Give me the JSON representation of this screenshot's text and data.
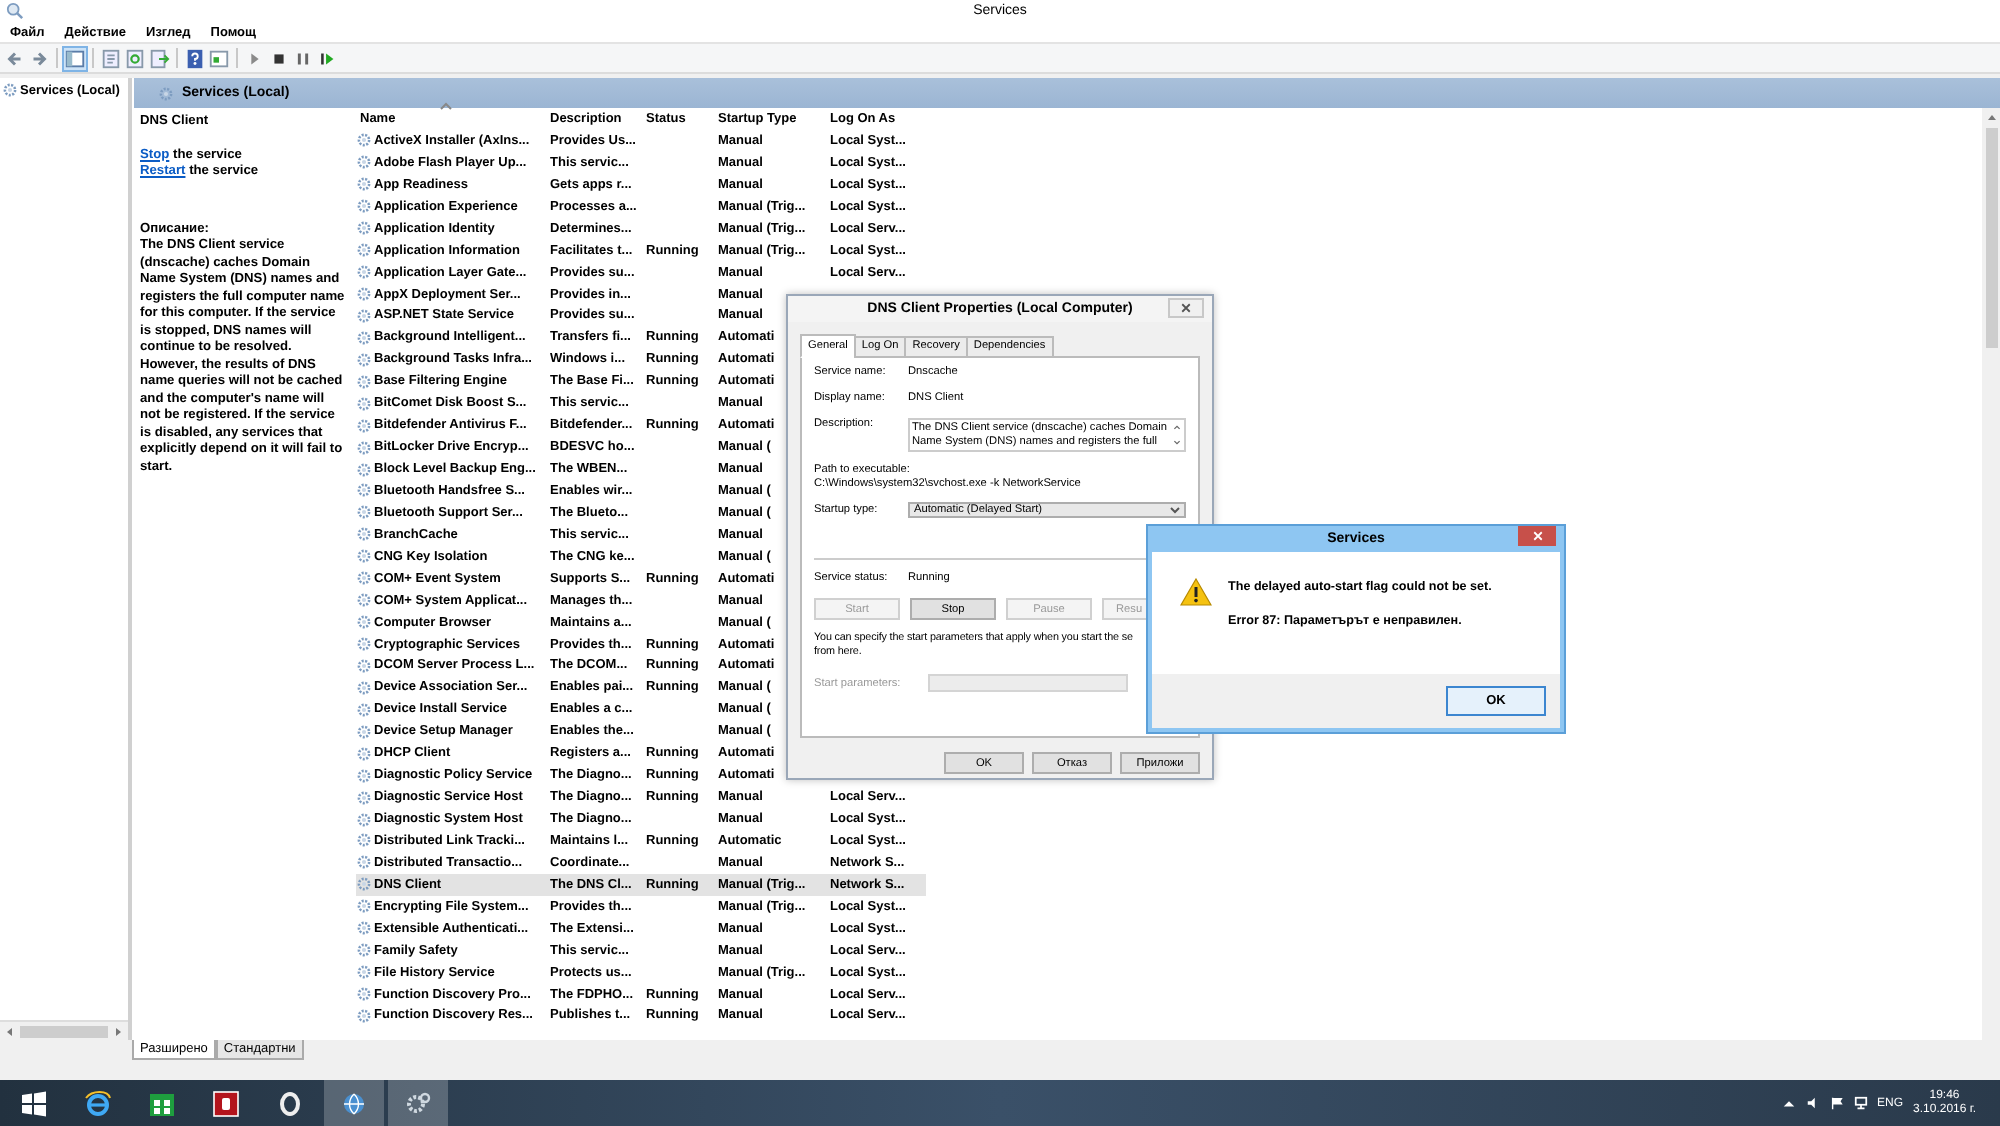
{
  "window": {
    "title": "Services"
  },
  "menu": [
    "Файл",
    "Действие",
    "Изглед",
    "Помощ"
  ],
  "tree": {
    "items": [
      {
        "label": "Services (Local)"
      }
    ]
  },
  "pane_title": "Services (Local)",
  "details": {
    "title": "DNS Client",
    "actions": [
      {
        "link": "Stop",
        "text": "the service"
      },
      {
        "link": "Restart",
        "text": "the service"
      }
    ],
    "description_label": "Описание:",
    "description": "The DNS Client service (dnscache) caches Domain Name System (DNS) names and registers the full computer name for this computer. If the service is stopped, DNS names will continue to be resolved. However, the results of DNS name queries will not be cached and the computer's name will not be registered. If the service is disabled, any services that explicitly depend on it will fail to start."
  },
  "table": {
    "columns": [
      "Name",
      "Description",
      "Status",
      "Startup Type",
      "Log On As"
    ],
    "rows": [
      {
        "name": "ActiveX Installer (AxIns...",
        "description": "Provides Us...",
        "status": "",
        "startup_type": "Manual",
        "log_on_as": "Local Syst...",
        "selected": false
      },
      {
        "name": "Adobe Flash Player Up...",
        "description": "This servic...",
        "status": "",
        "startup_type": "Manual",
        "log_on_as": "Local Syst...",
        "selected": false
      },
      {
        "name": "App Readiness",
        "description": "Gets apps r...",
        "status": "",
        "startup_type": "Manual",
        "log_on_as": "Local Syst...",
        "selected": false
      },
      {
        "name": "Application Experience",
        "description": "Processes a...",
        "status": "",
        "startup_type": "Manual (Trig...",
        "log_on_as": "Local Syst...",
        "selected": false
      },
      {
        "name": "Application Identity",
        "description": "Determines...",
        "status": "",
        "startup_type": "Manual (Trig...",
        "log_on_as": "Local Serv...",
        "selected": false
      },
      {
        "name": "Application Information",
        "description": "Facilitates t...",
        "status": "Running",
        "startup_type": "Manual (Trig...",
        "log_on_as": "Local Syst...",
        "selected": false
      },
      {
        "name": "Application Layer Gate...",
        "description": "Provides su...",
        "status": "",
        "startup_type": "Manual",
        "log_on_as": "Local Serv...",
        "selected": false
      },
      {
        "name": "AppX Deployment Ser...",
        "description": "Provides in...",
        "status": "",
        "startup_type": "Manual",
        "log_on_as": "",
        "selected": false
      },
      {
        "name": "ASP.NET State Service",
        "description": "Provides su...",
        "status": "",
        "startup_type": "Manual",
        "log_on_as": "",
        "selected": false
      },
      {
        "name": "Background Intelligent...",
        "description": "Transfers fi...",
        "status": "Running",
        "startup_type": "Automati",
        "log_on_as": "",
        "selected": false
      },
      {
        "name": "Background Tasks Infra...",
        "description": "Windows i...",
        "status": "Running",
        "startup_type": "Automati",
        "log_on_as": "",
        "selected": false
      },
      {
        "name": "Base Filtering Engine",
        "description": "The Base Fi...",
        "status": "Running",
        "startup_type": "Automati",
        "log_on_as": "",
        "selected": false
      },
      {
        "name": "BitComet Disk Boost S...",
        "description": "This servic...",
        "status": "",
        "startup_type": "Manual",
        "log_on_as": "",
        "selected": false
      },
      {
        "name": "Bitdefender Antivirus F...",
        "description": "Bitdefender...",
        "status": "Running",
        "startup_type": "Automati",
        "log_on_as": "",
        "selected": false
      },
      {
        "name": "BitLocker Drive Encryp...",
        "description": "BDESVC ho...",
        "status": "",
        "startup_type": "Manual (",
        "log_on_as": "",
        "selected": false
      },
      {
        "name": "Block Level Backup Eng...",
        "description": "The WBEN...",
        "status": "",
        "startup_type": "Manual",
        "log_on_as": "",
        "selected": false
      },
      {
        "name": "Bluetooth Handsfree S...",
        "description": "Enables wir...",
        "status": "",
        "startup_type": "Manual (",
        "log_on_as": "",
        "selected": false
      },
      {
        "name": "Bluetooth Support Ser...",
        "description": "The Blueto...",
        "status": "",
        "startup_type": "Manual (",
        "log_on_as": "",
        "selected": false
      },
      {
        "name": "BranchCache",
        "description": "This servic...",
        "status": "",
        "startup_type": "Manual",
        "log_on_as": "",
        "selected": false
      },
      {
        "name": "CNG Key Isolation",
        "description": "The CNG ke...",
        "status": "",
        "startup_type": "Manual (",
        "log_on_as": "",
        "selected": false
      },
      {
        "name": "COM+ Event System",
        "description": "Supports S...",
        "status": "Running",
        "startup_type": "Automati",
        "log_on_as": "",
        "selected": false
      },
      {
        "name": "COM+ System Applicat...",
        "description": "Manages th...",
        "status": "",
        "startup_type": "Manual",
        "log_on_as": "",
        "selected": false
      },
      {
        "name": "Computer Browser",
        "description": "Maintains a...",
        "status": "",
        "startup_type": "Manual (",
        "log_on_as": "",
        "selected": false
      },
      {
        "name": "Cryptographic Services",
        "description": "Provides th...",
        "status": "Running",
        "startup_type": "Automati",
        "log_on_as": "",
        "selected": false
      },
      {
        "name": "DCOM Server Process L...",
        "description": "The DCOM...",
        "status": "Running",
        "startup_type": "Automati",
        "log_on_as": "",
        "selected": false
      },
      {
        "name": "Device Association Ser...",
        "description": "Enables pai...",
        "status": "Running",
        "startup_type": "Manual (",
        "log_on_as": "",
        "selected": false
      },
      {
        "name": "Device Install Service",
        "description": "Enables a c...",
        "status": "",
        "startup_type": "Manual (",
        "log_on_as": "",
        "selected": false
      },
      {
        "name": "Device Setup Manager",
        "description": "Enables the...",
        "status": "",
        "startup_type": "Manual (",
        "log_on_as": "",
        "selected": false
      },
      {
        "name": "DHCP Client",
        "description": "Registers a...",
        "status": "Running",
        "startup_type": "Automati",
        "log_on_as": "",
        "selected": false
      },
      {
        "name": "Diagnostic Policy Service",
        "description": "The Diagno...",
        "status": "Running",
        "startup_type": "Automati",
        "log_on_as": "",
        "selected": false
      },
      {
        "name": "Diagnostic Service Host",
        "description": "The Diagno...",
        "status": "Running",
        "startup_type": "Manual",
        "log_on_as": "Local Serv...",
        "selected": false
      },
      {
        "name": "Diagnostic System Host",
        "description": "The Diagno...",
        "status": "",
        "startup_type": "Manual",
        "log_on_as": "Local Syst...",
        "selected": false
      },
      {
        "name": "Distributed Link Tracki...",
        "description": "Maintains l...",
        "status": "Running",
        "startup_type": "Automatic",
        "log_on_as": "Local Syst...",
        "selected": false
      },
      {
        "name": "Distributed Transactio...",
        "description": "Coordinate...",
        "status": "",
        "startup_type": "Manual",
        "log_on_as": "Network S...",
        "selected": false
      },
      {
        "name": "DNS Client",
        "description": "The DNS Cl...",
        "status": "Running",
        "startup_type": "Manual (Trig...",
        "log_on_as": "Network S...",
        "selected": true
      },
      {
        "name": "Encrypting File System...",
        "description": "Provides th...",
        "status": "",
        "startup_type": "Manual (Trig...",
        "log_on_as": "Local Syst...",
        "selected": false
      },
      {
        "name": "Extensible Authenticati...",
        "description": "The Extensi...",
        "status": "",
        "startup_type": "Manual",
        "log_on_as": "Local Syst...",
        "selected": false
      },
      {
        "name": "Family Safety",
        "description": "This servic...",
        "status": "",
        "startup_type": "Manual",
        "log_on_as": "Local Serv...",
        "selected": false
      },
      {
        "name": "File History Service",
        "description": "Protects us...",
        "status": "",
        "startup_type": "Manual (Trig...",
        "log_on_as": "Local Syst...",
        "selected": false
      },
      {
        "name": "Function Discovery Pro...",
        "description": "The FDPHO...",
        "status": "Running",
        "startup_type": "Manual",
        "log_on_as": "Local Serv...",
        "selected": false
      },
      {
        "name": "Function Discovery Res...",
        "description": "Publishes t...",
        "status": "Running",
        "startup_type": "Manual",
        "log_on_as": "Local Serv...",
        "selected": false
      }
    ]
  },
  "view_tabs": [
    {
      "label": "Разширено",
      "selected": true
    },
    {
      "label": "Стандартни",
      "selected": false
    }
  ],
  "properties_dialog": {
    "title": "DNS Client Properties (Local Computer)",
    "tabs": [
      {
        "label": "General",
        "selected": true
      },
      {
        "label": "Log On",
        "selected": false
      },
      {
        "label": "Recovery",
        "selected": false
      },
      {
        "label": "Dependencies",
        "selected": false
      }
    ],
    "service_name_label": "Service name:",
    "service_name": "Dnscache",
    "display_name_label": "Display name:",
    "display_name": "DNS Client",
    "description_label": "Description:",
    "description": "The DNS Client service (dnscache) caches Domain Name System (DNS) names and registers the full",
    "path_label": "Path to executable:",
    "path": "C:\\Windows\\system32\\svchost.exe -k NetworkService",
    "startup_type_label": "Startup type:",
    "startup_type": "Automatic (Delayed Start)",
    "status_label": "Service status:",
    "status": "Running",
    "control_buttons": [
      {
        "label": "Start",
        "disabled": true
      },
      {
        "label": "Stop",
        "disabled": false
      },
      {
        "label": "Pause",
        "disabled": true
      },
      {
        "label": "Resu",
        "disabled": true
      }
    ],
    "note_lines": [
      "You can specify the start parameters that apply when you start the se",
      "from here."
    ],
    "start_parameters_label": "Start parameters:",
    "start_parameters_disabled": true,
    "buttons": [
      "OK",
      "Отказ",
      "Приложи"
    ]
  },
  "message_box": {
    "title": "Services",
    "message": "The delayed auto-start flag could not be set.",
    "detail": "Error 87: Параметърът е неправилен.",
    "button": "OK"
  },
  "taskbar": {
    "language": "ENG",
    "time": "19:46",
    "date": "3.10.2016 г."
  }
}
